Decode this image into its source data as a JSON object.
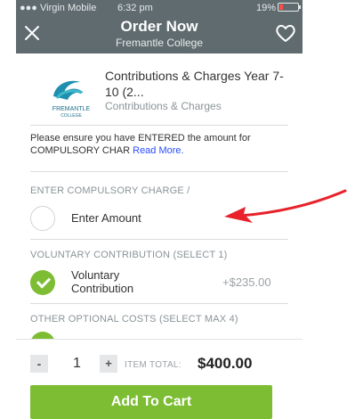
{
  "status": {
    "carrier": "●●● Virgin Mobile",
    "time": "6:32 pm",
    "battery": "19%"
  },
  "header": {
    "title": "Order Now",
    "subtitle": "Fremantle College"
  },
  "product": {
    "title": "Contributions & Charges Year 7-10 (2...",
    "category": "Contributions & Charges",
    "logo_text": "FREMANTLE",
    "logo_subtext": "COLLEGE"
  },
  "notice": {
    "text": "Please ensure you have ENTERED the amount for COMPULSORY CHAR",
    "link": "Read More."
  },
  "sections": {
    "compulsory": "ENTER COMPULSORY CHARGE /",
    "voluntary": "VOLUNTARY CONTRIBUTION (SELECT 1)",
    "optional": "OTHER OPTIONAL COSTS (SELECT MAX 4)"
  },
  "compulsory_option": {
    "label": "Enter Amount",
    "selected": false
  },
  "voluntary_option": {
    "label": "Voluntary Contribution",
    "price": "+$235.00",
    "selected": true
  },
  "footer": {
    "minus": "-",
    "quantity": "1",
    "plus": "+",
    "total_label": "ITEM TOTAL:",
    "total_value": "$400.00",
    "cta": "Add To Cart"
  },
  "colors": {
    "header": "#5f6b6f",
    "accent_green": "#7cbd33",
    "link_blue": "#2a4dff",
    "annotation_red": "#e8212a"
  }
}
